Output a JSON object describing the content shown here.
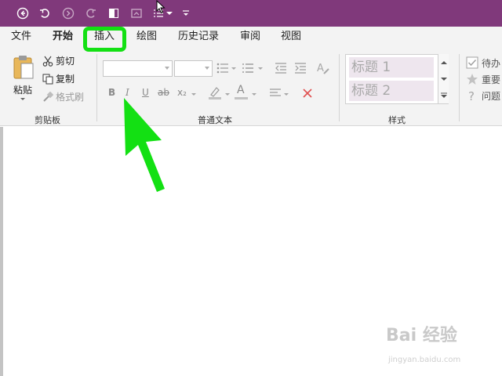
{
  "tabs": [
    {
      "label": "文件",
      "active": false
    },
    {
      "label": "开始",
      "active": true
    },
    {
      "label": "插入",
      "active": false
    },
    {
      "label": "绘图",
      "active": false
    },
    {
      "label": "历史记录",
      "active": false
    },
    {
      "label": "审阅",
      "active": false
    },
    {
      "label": "视图",
      "active": false
    }
  ],
  "clipboard": {
    "paste_label": "粘贴",
    "cut_label": "剪切",
    "copy_label": "复制",
    "format_painter_label": "格式刷",
    "group_label": "剪贴板"
  },
  "basic_text": {
    "group_label": "普通文本",
    "bold": "B",
    "italic": "I",
    "underline": "U",
    "strike": "ab",
    "subscript": "x₂",
    "font_color_letter": "A"
  },
  "styles": {
    "heading1": "标题 1",
    "heading2": "标题 2",
    "group_label": "样式"
  },
  "tags": {
    "todo": "待办",
    "important": "重要",
    "question": "问题"
  },
  "watermark": {
    "brand": "Bai 经验",
    "url": "jingyan.baidu.com"
  },
  "colors": {
    "titlebar": "#80397b",
    "highlight": "#13e013",
    "ribbon_bg": "#f3f3f3"
  },
  "icons": [
    "back-icon",
    "undo-icon",
    "forward-icon",
    "redo-icon",
    "dock-icon",
    "screen-clip-icon",
    "number-list-icon",
    "customize-icon"
  ]
}
